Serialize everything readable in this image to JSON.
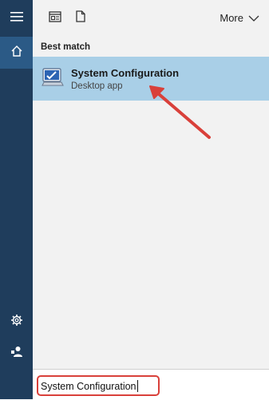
{
  "top_bar": {
    "more_label": "More"
  },
  "results": {
    "section_label": "Best match",
    "best_match": {
      "title": "System Configuration",
      "subtitle": "Desktop app"
    }
  },
  "search": {
    "value": "System Configuration"
  },
  "icons": {
    "menu": "hamburger-icon",
    "home": "home-icon",
    "settings": "gear-icon",
    "user": "user-icon",
    "apps": "apps-icon",
    "documents": "document-icon",
    "more": "chevron-down-icon",
    "app": "system-configuration-icon"
  },
  "colors": {
    "rail": "#1f3d5c",
    "rail_active": "#2b5a86",
    "highlight": "#a9cfe7",
    "annotation": "#d9403a"
  }
}
